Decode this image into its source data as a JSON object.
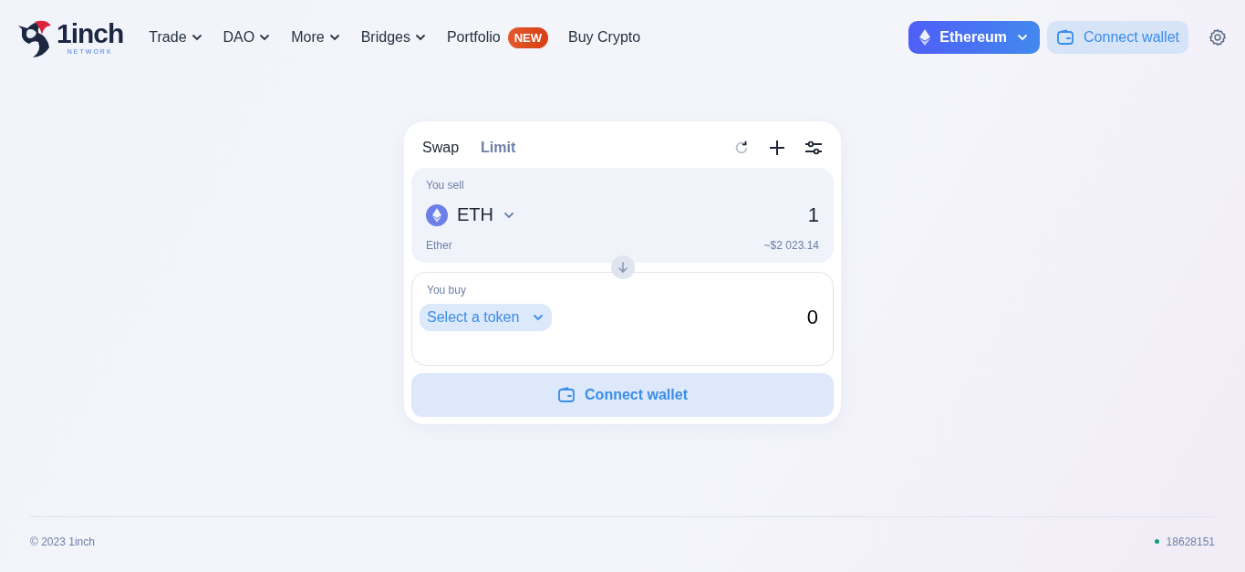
{
  "logo": {
    "name": "1inch",
    "sub": "NETWORK"
  },
  "nav": [
    {
      "label": "Trade",
      "dropdown": true
    },
    {
      "label": "DAO",
      "dropdown": true
    },
    {
      "label": "More",
      "dropdown": true
    },
    {
      "label": "Bridges",
      "dropdown": true
    },
    {
      "label": "Portfolio",
      "dropdown": false,
      "badge": "NEW"
    },
    {
      "label": "Buy Crypto",
      "dropdown": false
    }
  ],
  "network": {
    "label": "Ethereum"
  },
  "connect_wallet": "Connect wallet",
  "swap": {
    "tabs": [
      {
        "label": "Swap",
        "selected": true
      },
      {
        "label": "Limit",
        "selected": false
      }
    ],
    "sell": {
      "label": "You sell",
      "token": "ETH",
      "amount": "1",
      "token_name": "Ether",
      "usd": "~$2 023.14"
    },
    "buy": {
      "label": "You buy",
      "select": "Select a token",
      "amount": "0"
    },
    "button": "Connect wallet"
  },
  "footer": {
    "copyright": "© 2023 1inch",
    "block": "18628151"
  }
}
